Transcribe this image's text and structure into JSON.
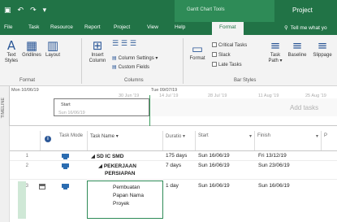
{
  "quick_access": {
    "save_icon": "save-icon",
    "undo_icon": "undo-icon",
    "redo_icon": "redo-icon",
    "customize_icon": "dropdown-arrow-icon"
  },
  "title_bar": {
    "context_label": "Gantt Chart Tools",
    "document_title": "Project"
  },
  "tabs": [
    "File",
    "Task",
    "Resource",
    "Report",
    "Project",
    "View",
    "Help",
    "Format"
  ],
  "active_tab": "Format",
  "tell_me": "Tell me what yo",
  "ribbon": {
    "format_group": {
      "label": "Format",
      "text_styles": "Text Styles",
      "gridlines": "Gridlines",
      "layout": "Layout"
    },
    "columns_group": {
      "label": "Columns",
      "insert_column": "Insert Column",
      "column_settings": "Column Settings",
      "custom_fields": "Custom Fields"
    },
    "bar_styles_group": {
      "label": "Bar Styles",
      "critical_tasks": "Critical Tasks",
      "slack": "Slack",
      "late_tasks": "Late Tasks",
      "format": "Format",
      "task_path": "Task Path",
      "baseline": "Baseline",
      "slippage": "Slippage"
    }
  },
  "timeline": {
    "side_label": "TIMELINE",
    "today_label": "Mon 10/06/19",
    "date_marker": "Tue 09/07/19",
    "scale_ticks": [
      "30 Jun '19",
      "14 Jul '19",
      "28 Jul '19",
      "11 Aug '19",
      "25 Aug '19"
    ],
    "start_label": "Start",
    "start_date": "Sun 16/06/19",
    "add_tasks": "Add tasks"
  },
  "grid": {
    "headers": {
      "mode": "Task Mode",
      "name": "Task Name",
      "duration": "Duratio",
      "start": "Start",
      "finish": "Finish",
      "predecessors": "P"
    },
    "rows": [
      {
        "id": "1",
        "name": "SD IC SMD",
        "duration": "175 days",
        "start": "Sun 16/06/19",
        "finish": "Fri 13/12/19"
      },
      {
        "id": "2",
        "name": "PEKERJAAN",
        "name_line2": "PERSIAPAN",
        "duration": "7 days",
        "start": "Sun 16/06/19",
        "finish": "Sun 23/06/19"
      },
      {
        "id": "3",
        "name": "Pembuatan",
        "name_line2": "Papan Nama",
        "name_line3": "Proyek",
        "duration": "1 day",
        "start": "Sun 16/06/19",
        "finish": "Sun 16/06/19"
      }
    ]
  },
  "colors": {
    "brand_green": "#217346",
    "selection_green": "#2e8b57",
    "task_mode_blue": "#2b6cb0"
  }
}
